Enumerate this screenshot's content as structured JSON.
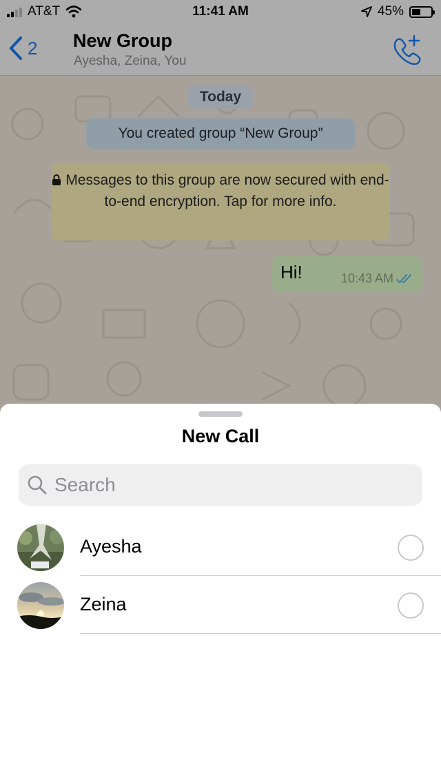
{
  "status_bar": {
    "carrier": "AT&T",
    "time": "11:41 AM",
    "battery": "45%"
  },
  "header": {
    "back_count": "2",
    "title": "New Group",
    "subtitle": "Ayesha, Zeina, You"
  },
  "chat": {
    "date_label": "Today",
    "created_notice": "You created group “New Group”",
    "encryption_notice": "Messages to this group are now secured with end-to-end encryption. Tap for more info.",
    "message": {
      "text": "Hi!",
      "time": "10:43 AM"
    }
  },
  "sheet": {
    "title": "New Call",
    "search_placeholder": "Search",
    "contacts": [
      {
        "name": "Ayesha",
        "selected": false
      },
      {
        "name": "Zeina",
        "selected": false
      }
    ]
  },
  "colors": {
    "accent": "#1a7cf4",
    "outgoing_bubble": "#dcf8c6",
    "encryption_bg": "#fbefb8"
  }
}
